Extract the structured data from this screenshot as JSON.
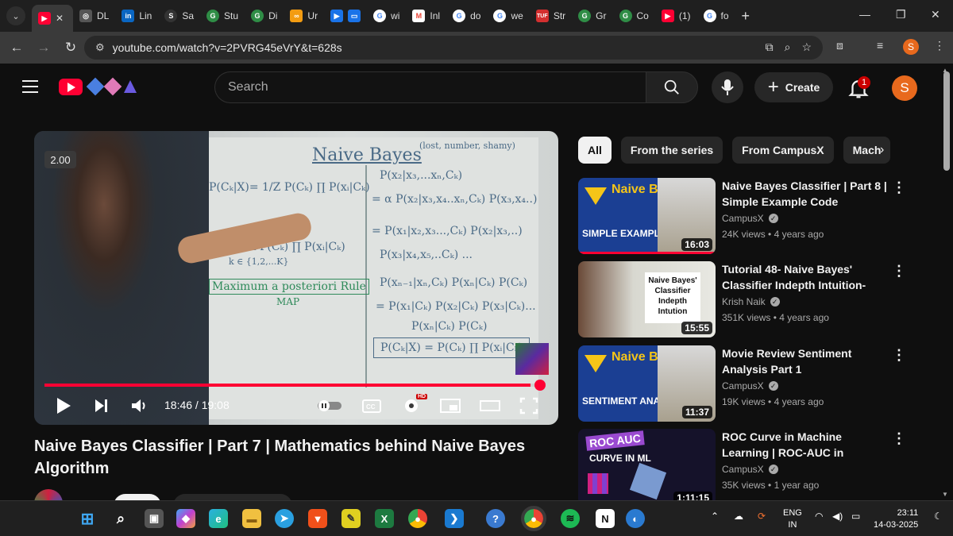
{
  "browser": {
    "tabs": [
      {
        "label": "",
        "favicon": "youtube-icon",
        "color": "#ff0033"
      },
      {
        "label": "DL",
        "favicon": "chatgpt-icon",
        "color": "#555555"
      },
      {
        "label": "Lin",
        "favicon": "linkedin-icon",
        "color": "#0a66c2"
      },
      {
        "label": "Sa",
        "favicon": "s-logo-icon",
        "color": "#333333"
      },
      {
        "label": "Stu",
        "favicon": "gfg-icon",
        "color": "#2f8d46"
      },
      {
        "label": "Di",
        "favicon": "gfg-icon",
        "color": "#2f8d46"
      },
      {
        "label": "Ur",
        "favicon": "infinity-icon",
        "color": "#f39c12"
      },
      {
        "label": "",
        "favicon": "play-icon",
        "color": "#1a73e8"
      },
      {
        "label": "wi",
        "favicon": "google-icon",
        "color": "#4285f4"
      },
      {
        "label": "Inl",
        "favicon": "gmail-icon",
        "color": "#ea4335"
      },
      {
        "label": "do",
        "favicon": "google-icon",
        "color": "#4285f4"
      },
      {
        "label": "we",
        "favicon": "google-icon",
        "color": "#4285f4"
      },
      {
        "label": "Str",
        "favicon": "tuf-icon",
        "color": "#d32f2f"
      },
      {
        "label": "Gr",
        "favicon": "gfg-icon",
        "color": "#2f8d46"
      },
      {
        "label": "Co",
        "favicon": "gfg-icon",
        "color": "#2f8d46"
      },
      {
        "label": "(1)",
        "favicon": "youtube-icon",
        "color": "#ff0033"
      },
      {
        "label": "fo",
        "favicon": "google-icon",
        "color": "#4285f4"
      }
    ],
    "url": "youtube.com/watch?v=2PVRG45eVrY&t=628s",
    "profile_initial": "S"
  },
  "youtube": {
    "search_placeholder": "Search",
    "create_label": "Create",
    "notification_count": "1",
    "avatar_initial": "S",
    "accent": "#ff0033"
  },
  "player": {
    "speed_badge": "2.00",
    "current_time": "18:46",
    "duration": "19:08",
    "progress_fraction": 0.98,
    "hd_badge": "HD",
    "board": {
      "heading": "Naive Bayes",
      "note": "(lost, number, shamy)"
    }
  },
  "video": {
    "title": "Naive Bayes Classifier | Part 7 | Mathematics behind Naive Bayes Algorithm"
  },
  "chips": [
    "All",
    "From the series",
    "From CampusX",
    "Mach"
  ],
  "recommendations": [
    {
      "title": "Naive Bayes Classifier | Part 8 | Simple Example Code",
      "channel": "CampusX",
      "views": "24K views",
      "age": "4 years ago",
      "duration": "16:03",
      "thumb_title": "Naive Bayes",
      "thumb_sub": "SIMPLE EXAMPLE"
    },
    {
      "title": "Tutorial 48- Naive Bayes' Classifier Indepth Intuition- Machine Learning",
      "channel": "Krish Naik",
      "views": "351K views",
      "age": "4 years ago",
      "duration": "15:55",
      "thumb_title": "Naive Bayes' Classifier Indepth Intution"
    },
    {
      "title": "Movie Review Sentiment Analysis Part 1",
      "channel": "CampusX",
      "views": "19K views",
      "age": "4 years ago",
      "duration": "11:37",
      "thumb_title": "Naive Bayes",
      "thumb_sub": "SENTIMENT ANALYSIS"
    },
    {
      "title": "ROC Curve in Machine Learning | ROC-AUC in Machine Learning",
      "channel": "CampusX",
      "views": "35K views",
      "age": "1 year ago",
      "duration": "1:11:15",
      "thumb_title": "ROC AUC",
      "thumb_sub": "CURVE IN ML"
    }
  ],
  "taskbar": {
    "lang_top": "ENG",
    "lang_bottom": "IN",
    "time": "23:11",
    "date": "14-03-2025"
  }
}
